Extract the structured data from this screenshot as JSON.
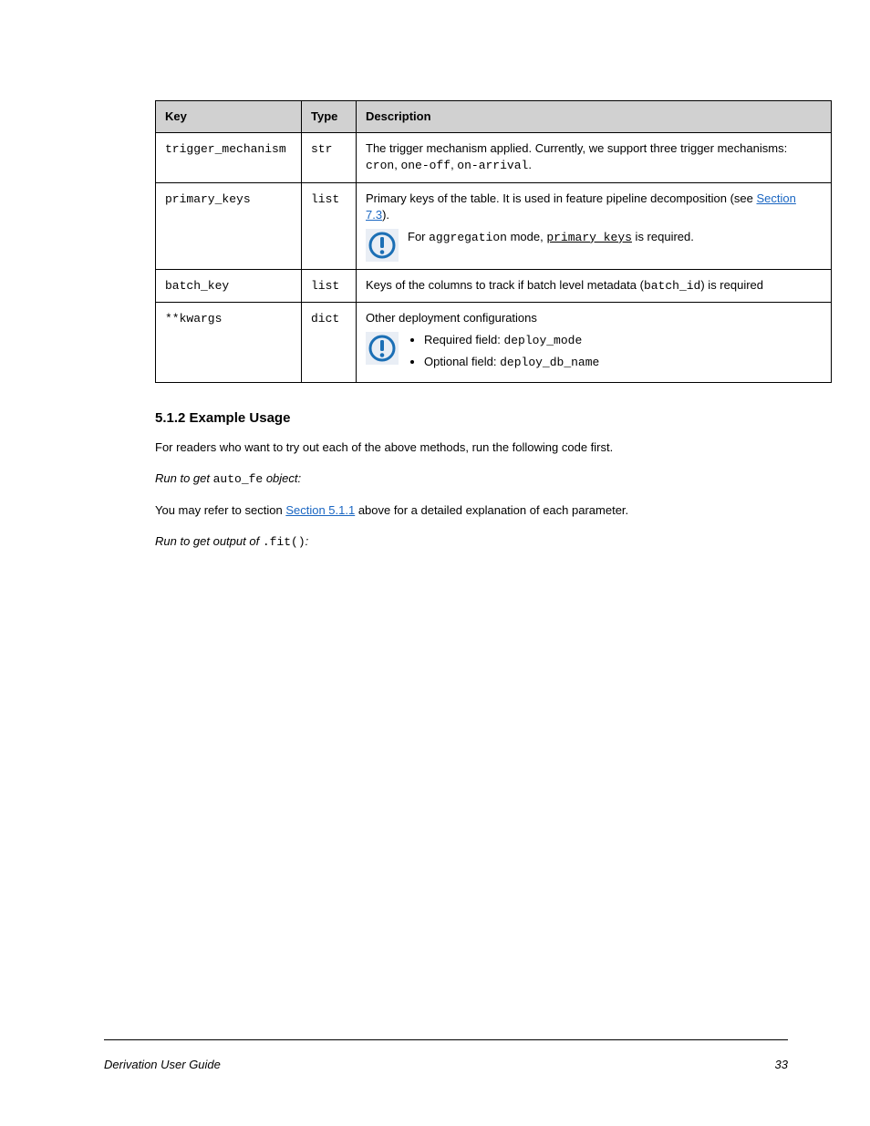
{
  "table": {
    "headers": [
      "Key",
      "Type",
      "Description"
    ],
    "rows": {
      "trigger": {
        "key": "trigger_mechanism",
        "type": "str",
        "desc": "The trigger mechanism applied. Currently, we support three trigger mechanisms: ",
        "desc_tail": "."
      },
      "primary": {
        "key": "primary_keys",
        "type": "list",
        "desc": "Primary keys of the table. It is used in feature pipeline decomposition (see ",
        "see": "Section 7.3",
        "desc_tail": ").",
        "note_prefix": "For ",
        "note_mode": "aggregation",
        "note_mid": " mode, ",
        "note_key": "primary_keys",
        "note_suffix": " is required."
      },
      "batch_key": {
        "key": "batch_key",
        "type": "list",
        "desc_prefix": "Keys of the columns to track if batch level metadata (",
        "desc_field": "batch_id",
        "desc_suffix": ") is required"
      },
      "kwargs": {
        "key": "**kwargs",
        "type": "dict",
        "desc": "Other deployment configurations",
        "note_items": [
          {
            "prefix": "Required field: ",
            "val": "deploy_mode"
          },
          {
            "prefix": "Optional field: ",
            "val": "deploy_db_name"
          }
        ]
      }
    }
  },
  "section": "5.1.2 Example Usage",
  "body": {
    "p1": "For readers who want to try out each of the above methods, run the following code first.",
    "run_label": "Run to get ",
    "run_obj": "auto_fe",
    "run_suffix": " object:",
    "p2": "You may refer to section ",
    "p2_link": "Section 5.1.1",
    "p2_tail": " above for a detailed explanation of each parameter.",
    "run2_label": "Run to get output of ",
    "run2_fn": ".fit()",
    "run2_suffix": ":"
  },
  "footer": {
    "title": "Derivation User Guide",
    "page": "33"
  }
}
